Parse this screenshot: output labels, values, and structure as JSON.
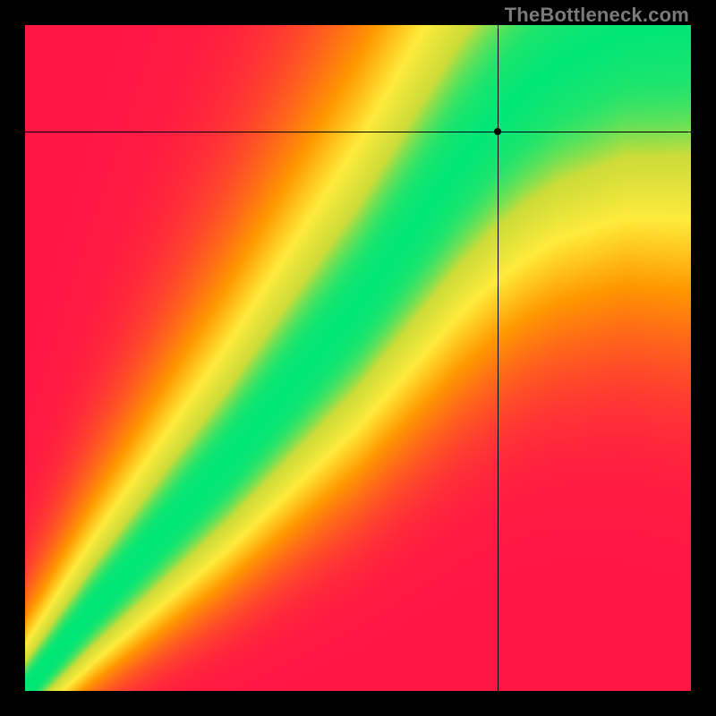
{
  "watermark": "TheBottleneck.com",
  "chart_data": {
    "type": "heatmap",
    "title": "",
    "xlabel": "",
    "ylabel": "",
    "xlim": [
      0,
      100
    ],
    "ylim": [
      0,
      100
    ],
    "crosshair": {
      "x": 71,
      "y": 84
    },
    "colormap": {
      "description": "red-yellow-green where green is optimal match",
      "stops": [
        {
          "v": 0.0,
          "color": "#ff1744"
        },
        {
          "v": 0.45,
          "color": "#ff9800"
        },
        {
          "v": 0.7,
          "color": "#ffeb3b"
        },
        {
          "v": 0.88,
          "color": "#cddc39"
        },
        {
          "v": 1.0,
          "color": "#00e676"
        }
      ]
    },
    "optimal_curve": {
      "description": "green ridge of optimal GPU/CPU match, x→y mapping",
      "points": [
        {
          "x": 0,
          "y": 0
        },
        {
          "x": 10,
          "y": 12
        },
        {
          "x": 20,
          "y": 23
        },
        {
          "x": 30,
          "y": 34
        },
        {
          "x": 40,
          "y": 46
        },
        {
          "x": 50,
          "y": 58
        },
        {
          "x": 55,
          "y": 65
        },
        {
          "x": 60,
          "y": 72
        },
        {
          "x": 65,
          "y": 79
        },
        {
          "x": 70,
          "y": 85
        },
        {
          "x": 75,
          "y": 90
        },
        {
          "x": 80,
          "y": 94
        },
        {
          "x": 90,
          "y": 99
        },
        {
          "x": 100,
          "y": 100
        }
      ],
      "band_width_start": 2,
      "band_width_end": 14
    }
  },
  "layout": {
    "canvas_size": 744,
    "margin": 28
  }
}
